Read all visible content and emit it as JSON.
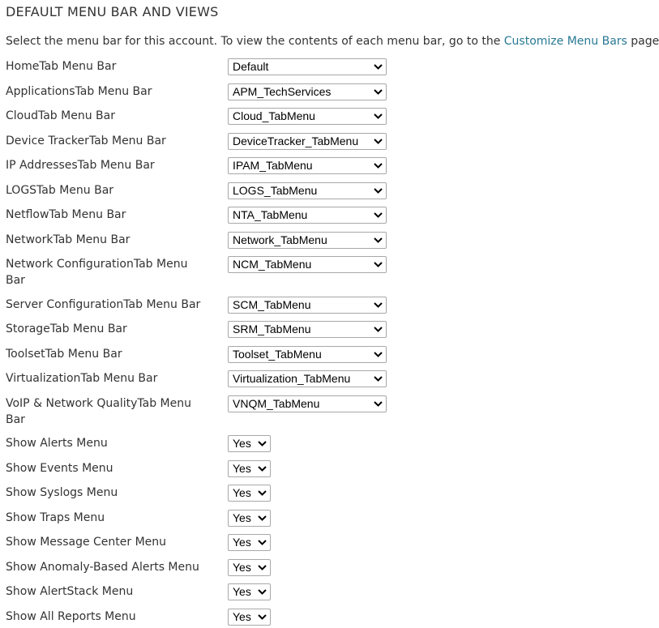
{
  "header": {
    "title": "DEFAULT MENU BAR AND VIEWS"
  },
  "intro": {
    "text_before": "Select the menu bar for this account. To view the contents of each menu bar, go to the ",
    "link_text": "Customize Menu Bars",
    "text_after": " page."
  },
  "menu_bars": [
    {
      "label": "HomeTab Menu Bar",
      "value": "Default"
    },
    {
      "label": "ApplicationsTab Menu Bar",
      "value": "APM_TechServices"
    },
    {
      "label": "CloudTab Menu Bar",
      "value": "Cloud_TabMenu"
    },
    {
      "label": "Device TrackerTab Menu Bar",
      "value": "DeviceTracker_TabMenu"
    },
    {
      "label": "IP AddressesTab Menu Bar",
      "value": "IPAM_TabMenu"
    },
    {
      "label": "LOGSTab Menu Bar",
      "value": "LOGS_TabMenu"
    },
    {
      "label": "NetflowTab Menu Bar",
      "value": "NTA_TabMenu"
    },
    {
      "label": "NetworkTab Menu Bar",
      "value": "Network_TabMenu"
    },
    {
      "label": "Network ConfigurationTab Menu Bar",
      "value": "NCM_TabMenu"
    },
    {
      "label": "Server ConfigurationTab Menu Bar",
      "value": "SCM_TabMenu"
    },
    {
      "label": "StorageTab Menu Bar",
      "value": "SRM_TabMenu"
    },
    {
      "label": "ToolsetTab Menu Bar",
      "value": "Toolset_TabMenu"
    },
    {
      "label": "VirtualizationTab Menu Bar",
      "value": "Virtualization_TabMenu"
    },
    {
      "label": "VoIP & Network QualityTab Menu Bar",
      "value": "VNQM_TabMenu"
    }
  ],
  "show_menus": [
    {
      "label": "Show Alerts Menu",
      "value": "Yes"
    },
    {
      "label": "Show Events Menu",
      "value": "Yes"
    },
    {
      "label": "Show Syslogs Menu",
      "value": "Yes"
    },
    {
      "label": "Show Traps Menu",
      "value": "Yes"
    },
    {
      "label": "Show Message Center Menu",
      "value": "Yes"
    },
    {
      "label": "Show Anomaly-Based Alerts Menu",
      "value": "Yes"
    },
    {
      "label": "Show AlertStack Menu",
      "value": "Yes"
    },
    {
      "label": "Show All Reports Menu",
      "value": "Yes"
    }
  ],
  "icons": {
    "dropdown": "chevron-down-icon"
  },
  "colors": {
    "text": "#333333",
    "link": "#297994",
    "select_border": "#a8a8a8"
  }
}
